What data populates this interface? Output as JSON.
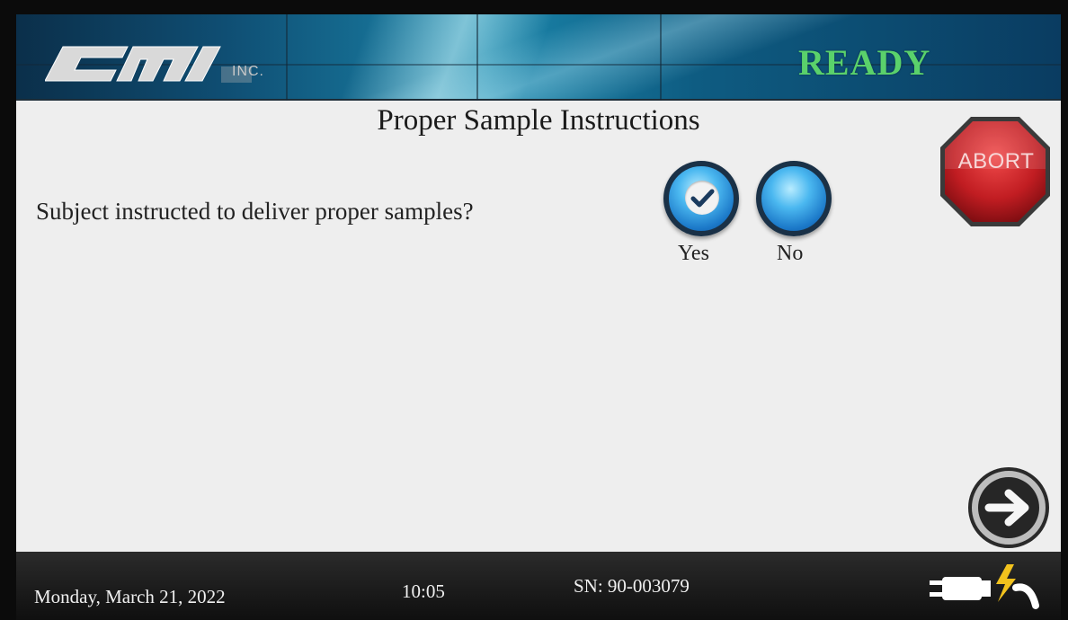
{
  "header": {
    "logo_text": "CMI INC.",
    "status": "READY",
    "status_color": "#5ad16b",
    "background_color": "#1b86ab"
  },
  "main": {
    "title": "Proper Sample Instructions",
    "question": "Subject instructed to deliver proper samples?",
    "options": [
      {
        "label": "Yes",
        "selected": true,
        "icon": "check-icon"
      },
      {
        "label": "No",
        "selected": false
      }
    ],
    "abort_label": "ABORT",
    "abort_color": "#c9262a",
    "next_icon": "arrow-right-icon"
  },
  "footer": {
    "date": "Monday, March 21, 2022",
    "time": "10:05",
    "serial": "SN: 90-003079",
    "power_icon": "ac-power-plug-icon"
  }
}
